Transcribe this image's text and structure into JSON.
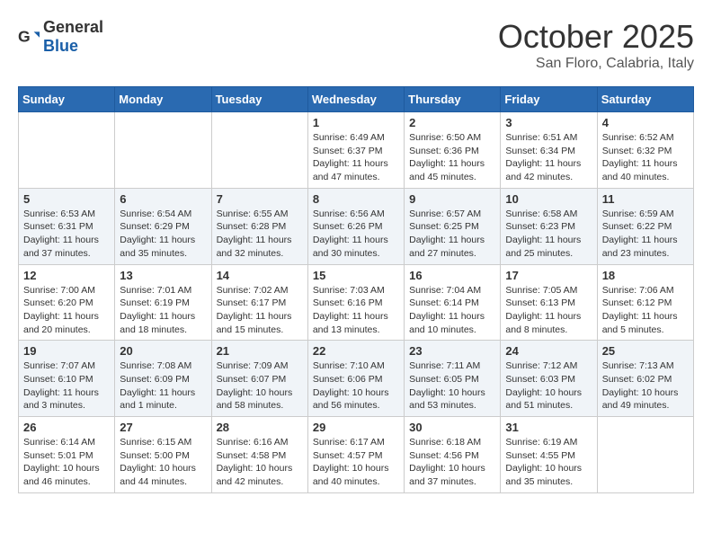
{
  "header": {
    "logo_general": "General",
    "logo_blue": "Blue",
    "month": "October 2025",
    "location": "San Floro, Calabria, Italy"
  },
  "weekdays": [
    "Sunday",
    "Monday",
    "Tuesday",
    "Wednesday",
    "Thursday",
    "Friday",
    "Saturday"
  ],
  "weeks": [
    [
      {
        "day": "",
        "info": ""
      },
      {
        "day": "",
        "info": ""
      },
      {
        "day": "",
        "info": ""
      },
      {
        "day": "1",
        "info": "Sunrise: 6:49 AM\nSunset: 6:37 PM\nDaylight: 11 hours\nand 47 minutes."
      },
      {
        "day": "2",
        "info": "Sunrise: 6:50 AM\nSunset: 6:36 PM\nDaylight: 11 hours\nand 45 minutes."
      },
      {
        "day": "3",
        "info": "Sunrise: 6:51 AM\nSunset: 6:34 PM\nDaylight: 11 hours\nand 42 minutes."
      },
      {
        "day": "4",
        "info": "Sunrise: 6:52 AM\nSunset: 6:32 PM\nDaylight: 11 hours\nand 40 minutes."
      }
    ],
    [
      {
        "day": "5",
        "info": "Sunrise: 6:53 AM\nSunset: 6:31 PM\nDaylight: 11 hours\nand 37 minutes."
      },
      {
        "day": "6",
        "info": "Sunrise: 6:54 AM\nSunset: 6:29 PM\nDaylight: 11 hours\nand 35 minutes."
      },
      {
        "day": "7",
        "info": "Sunrise: 6:55 AM\nSunset: 6:28 PM\nDaylight: 11 hours\nand 32 minutes."
      },
      {
        "day": "8",
        "info": "Sunrise: 6:56 AM\nSunset: 6:26 PM\nDaylight: 11 hours\nand 30 minutes."
      },
      {
        "day": "9",
        "info": "Sunrise: 6:57 AM\nSunset: 6:25 PM\nDaylight: 11 hours\nand 27 minutes."
      },
      {
        "day": "10",
        "info": "Sunrise: 6:58 AM\nSunset: 6:23 PM\nDaylight: 11 hours\nand 25 minutes."
      },
      {
        "day": "11",
        "info": "Sunrise: 6:59 AM\nSunset: 6:22 PM\nDaylight: 11 hours\nand 23 minutes."
      }
    ],
    [
      {
        "day": "12",
        "info": "Sunrise: 7:00 AM\nSunset: 6:20 PM\nDaylight: 11 hours\nand 20 minutes."
      },
      {
        "day": "13",
        "info": "Sunrise: 7:01 AM\nSunset: 6:19 PM\nDaylight: 11 hours\nand 18 minutes."
      },
      {
        "day": "14",
        "info": "Sunrise: 7:02 AM\nSunset: 6:17 PM\nDaylight: 11 hours\nand 15 minutes."
      },
      {
        "day": "15",
        "info": "Sunrise: 7:03 AM\nSunset: 6:16 PM\nDaylight: 11 hours\nand 13 minutes."
      },
      {
        "day": "16",
        "info": "Sunrise: 7:04 AM\nSunset: 6:14 PM\nDaylight: 11 hours\nand 10 minutes."
      },
      {
        "day": "17",
        "info": "Sunrise: 7:05 AM\nSunset: 6:13 PM\nDaylight: 11 hours\nand 8 minutes."
      },
      {
        "day": "18",
        "info": "Sunrise: 7:06 AM\nSunset: 6:12 PM\nDaylight: 11 hours\nand 5 minutes."
      }
    ],
    [
      {
        "day": "19",
        "info": "Sunrise: 7:07 AM\nSunset: 6:10 PM\nDaylight: 11 hours\nand 3 minutes."
      },
      {
        "day": "20",
        "info": "Sunrise: 7:08 AM\nSunset: 6:09 PM\nDaylight: 11 hours\nand 1 minute."
      },
      {
        "day": "21",
        "info": "Sunrise: 7:09 AM\nSunset: 6:07 PM\nDaylight: 10 hours\nand 58 minutes."
      },
      {
        "day": "22",
        "info": "Sunrise: 7:10 AM\nSunset: 6:06 PM\nDaylight: 10 hours\nand 56 minutes."
      },
      {
        "day": "23",
        "info": "Sunrise: 7:11 AM\nSunset: 6:05 PM\nDaylight: 10 hours\nand 53 minutes."
      },
      {
        "day": "24",
        "info": "Sunrise: 7:12 AM\nSunset: 6:03 PM\nDaylight: 10 hours\nand 51 minutes."
      },
      {
        "day": "25",
        "info": "Sunrise: 7:13 AM\nSunset: 6:02 PM\nDaylight: 10 hours\nand 49 minutes."
      }
    ],
    [
      {
        "day": "26",
        "info": "Sunrise: 6:14 AM\nSunset: 5:01 PM\nDaylight: 10 hours\nand 46 minutes."
      },
      {
        "day": "27",
        "info": "Sunrise: 6:15 AM\nSunset: 5:00 PM\nDaylight: 10 hours\nand 44 minutes."
      },
      {
        "day": "28",
        "info": "Sunrise: 6:16 AM\nSunset: 4:58 PM\nDaylight: 10 hours\nand 42 minutes."
      },
      {
        "day": "29",
        "info": "Sunrise: 6:17 AM\nSunset: 4:57 PM\nDaylight: 10 hours\nand 40 minutes."
      },
      {
        "day": "30",
        "info": "Sunrise: 6:18 AM\nSunset: 4:56 PM\nDaylight: 10 hours\nand 37 minutes."
      },
      {
        "day": "31",
        "info": "Sunrise: 6:19 AM\nSunset: 4:55 PM\nDaylight: 10 hours\nand 35 minutes."
      },
      {
        "day": "",
        "info": ""
      }
    ]
  ]
}
